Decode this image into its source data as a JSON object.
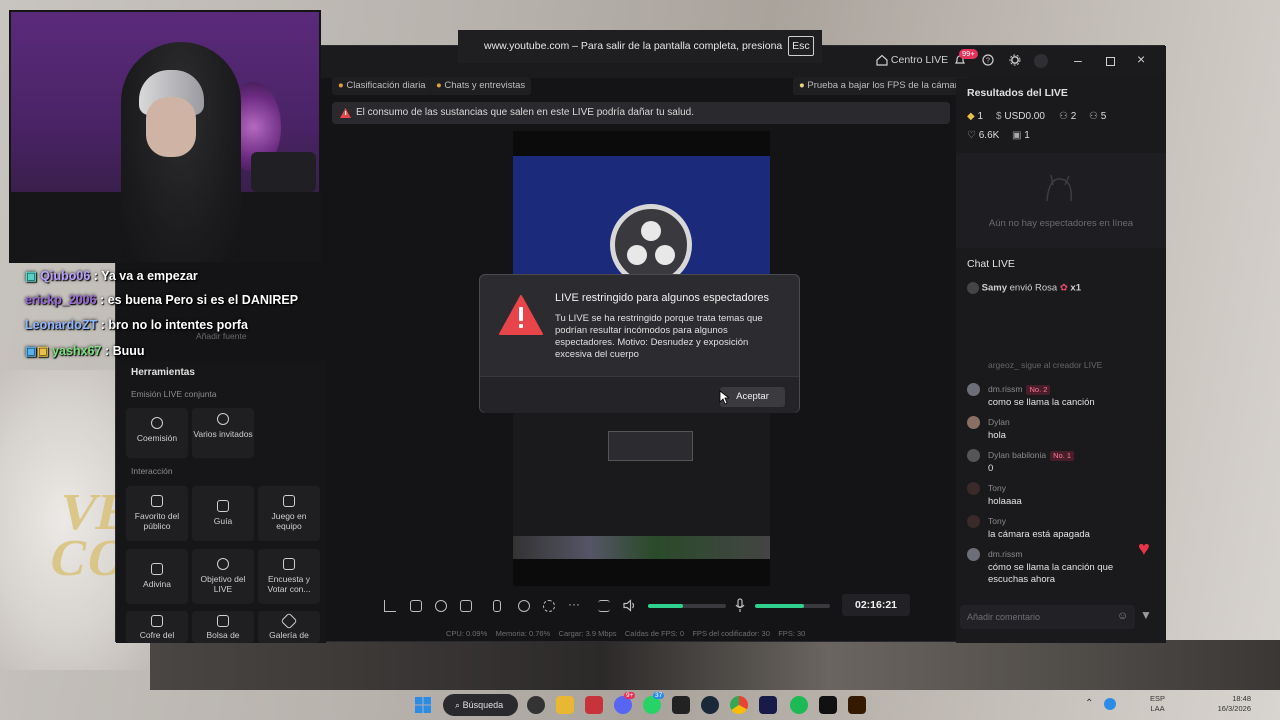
{
  "fullscreen_notice": {
    "text": "www.youtube.com – Para salir de la pantalla completa, presiona",
    "key": "Esc"
  },
  "app": {
    "topbar": {
      "centro_live": "Centro LIVE",
      "notif_count": "99+"
    },
    "chips": {
      "daily": "Clasificación diaria",
      "chats": "Chats y entrevistas",
      "fps_test": "Prueba a bajar los FPS de la cámara"
    },
    "warning": "El consumo de las sustancias que salen en este LIVE podría dañar tu salud.",
    "right": {
      "results_title": "Resultados del LIVE",
      "stats": {
        "diamonds": "1",
        "usd": "USD0.00",
        "users": "2",
        "followers": "5",
        "likes": "6.6K",
        "gifts": "1"
      },
      "no_viewers": "Aún no hay espectadores en línea",
      "chat_title": "Chat LIVE",
      "gift_notice": {
        "user": "Samy",
        "text": "envió Rosa",
        "count": "x1"
      },
      "partial_msg": "argeoz_ sigue al creador LIVE",
      "messages": [
        {
          "user": "dm.rissm",
          "badge": "No. 2",
          "text": "como se llama la canción"
        },
        {
          "user": "Dylan",
          "badge": "",
          "text": "hola"
        },
        {
          "user": "Dylan babilonia",
          "badge": "No. 1",
          "text": "0"
        },
        {
          "user": "Tony",
          "badge": "",
          "text": "holaaaa"
        },
        {
          "user": "Tony",
          "badge": "",
          "text": "la cámara está apagada"
        },
        {
          "user": "dm.rissm",
          "badge": "",
          "text": "cómo se llama la canción que escuchas ahora"
        }
      ],
      "comment_placeholder": "Añadir comentario"
    },
    "tools": {
      "add_source": "Añadir fuente",
      "title": "Herramientas",
      "section_joint": "Emisión LIVE conjunta",
      "coemision": "Coemisión",
      "varios": "Varios invitados",
      "section_interaction": "Interacción",
      "favorito": "Favorito del público",
      "guia": "Guía",
      "juego": "Juego en equipo",
      "adivina": "Adivina",
      "objetivo": "Objetivo del LIVE",
      "encuesta": "Encuesta y Votar con...",
      "cofre": "Cofre del",
      "bolsa": "Bolsa de",
      "galeria": "Galería de"
    },
    "timer": "02:16:21",
    "stats_line": "CPU: 0.09%    Memoria: 0.76%    Cargar: 3.9 Mbps    Caídas de FPS: 0    FPS del codificador: 30    FPS: 30",
    "audio_levels": {
      "system": 0.45,
      "mic": 0.65
    }
  },
  "dialog": {
    "title": "LIVE restringido para algunos espectadores",
    "body": "Tu LIVE se ha restringido porque trata temas que podrían resultar incómodos para algunos espectadores. Motivo: Desnudez y exposición excesiva del cuerpo",
    "accept": "Aceptar"
  },
  "overlay_chat": [
    {
      "user": "Qiubo06",
      "text": ": Ya va a empezar",
      "color": "#b9a3ff"
    },
    {
      "user": "erickp_2006",
      "text": ": es buena Pero si es el DANIREP",
      "color": "#9b6bd6"
    },
    {
      "user": "LeonardoZT",
      "text": ": bro no lo intentes porfa",
      "color": "#8fb6ff"
    },
    {
      "user": "yashx67",
      "text": ": Buuu",
      "color": "#7ee07e"
    }
  ],
  "hoodie_text": "VER\nCO",
  "taskbar": {
    "search": "Búsqueda",
    "lang": "ESP",
    "lang2": "LAA",
    "time": "18:48",
    "date": "16/3/2026",
    "badges": {
      "discord": "9+",
      "whatsapp": "37"
    }
  }
}
